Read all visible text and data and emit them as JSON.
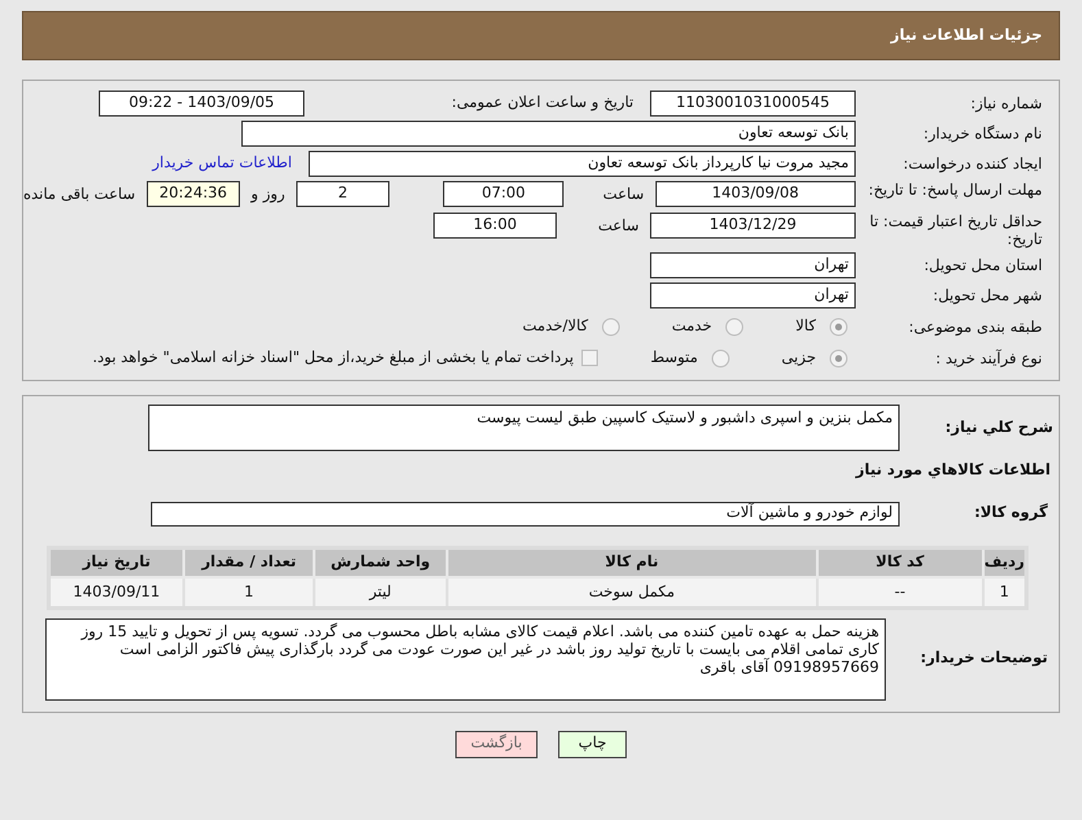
{
  "page_title": "جزئیات اطلاعات نیاز",
  "need_number": {
    "label": "شماره نیاز:",
    "value": "1103001031000545"
  },
  "announce_date": {
    "label": "تاریخ و ساعت اعلان عمومی:",
    "value": "1403/09/05 - 09:22"
  },
  "buyer_org": {
    "label": "نام دستگاه خریدار:",
    "value": "بانک توسعه تعاون"
  },
  "requester": {
    "label": "ایجاد کننده درخواست:",
    "value": "مجید مروت نیا کارپرداز بانک توسعه تعاون",
    "link": "اطلاعات تماس خریدار"
  },
  "response_deadline": {
    "label": "مهلت ارسال پاسخ: تا تاریخ:",
    "date": "1403/09/08",
    "time_label": "ساعت",
    "time": "07:00",
    "days": "2",
    "days_label": "روز و",
    "remaining": "20:24:36",
    "remaining_label": "ساعت باقی مانده"
  },
  "price_validity": {
    "label": "حداقل تاریخ اعتبار قیمت: تا تاریخ:",
    "date": "1403/12/29",
    "time_label": "ساعت",
    "time": "16:00"
  },
  "province": {
    "label": "استان محل تحویل:",
    "value": "تهران"
  },
  "city": {
    "label": "شهر محل تحویل:",
    "value": "تهران"
  },
  "category": {
    "label": "طبقه بندی موضوعی:",
    "options": [
      {
        "label": "کالا",
        "selected": true
      },
      {
        "label": "خدمت",
        "selected": false
      },
      {
        "label": "کالا/خدمت",
        "selected": false
      }
    ]
  },
  "purchase_type": {
    "label": "نوع فرآیند خرید :",
    "options": [
      {
        "label": "جزیی",
        "selected": true
      },
      {
        "label": "متوسط",
        "selected": false
      }
    ],
    "treasury": {
      "checked": false,
      "text": "پرداخت تمام یا بخشی از مبلغ خرید،از محل \"اسناد خزانه اسلامی\" خواهد بود."
    }
  },
  "summary": {
    "label": "شرح کلي نیاز:",
    "value": "مکمل بنزین و اسپری داشبور و لاستیک کاسپین طبق لیست پیوست"
  },
  "goods_heading": "اطلاعات کالاهاي مورد نياز",
  "goods_group": {
    "label": "گروه کالا:",
    "value": "لوازم خودرو و ماشین آلات"
  },
  "table": {
    "columns": [
      "ردیف",
      "کد کالا",
      "نام کالا",
      "واحد شمارش",
      "تعداد / مقدار",
      "تاریخ نیاز"
    ],
    "rows": [
      [
        "1",
        "--",
        "مکمل سوخت",
        "لیتر",
        "1",
        "1403/09/11"
      ]
    ]
  },
  "buyer_notes": {
    "label": "توضیحات خریدار:",
    "value": "هزینه حمل به عهده تامین کننده می باشد. اعلام قیمت کالای مشابه باطل محسوب می گردد. تسویه پس از تحویل و تایید 15 روز کاری تمامی اقلام می بایست با تاریخ تولید روز باشد در غیر این صورت عودت می گردد بارگذاری پیش فاکتور الزامی است  09198957669 آقای باقری"
  },
  "buttons": [
    {
      "label": "چاپ",
      "kind": "print"
    },
    {
      "label": "بازگشت",
      "kind": "back"
    }
  ]
}
